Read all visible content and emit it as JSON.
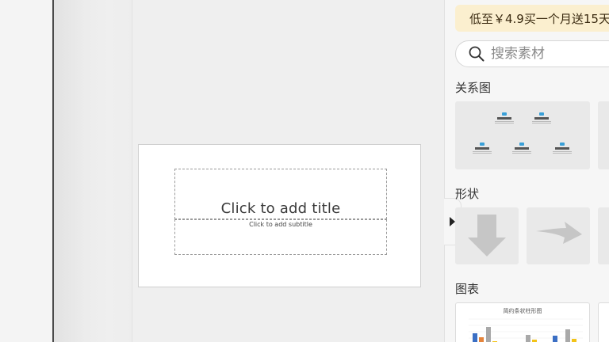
{
  "slide": {
    "title_placeholder": "Click to add title",
    "subtitle_placeholder": "Click to add subtitle"
  },
  "panel": {
    "promo_text": "低至￥4.9买一个月送15天",
    "search_placeholder": "搜索素材",
    "sections": {
      "relation": "关系图",
      "shapes": "形状",
      "charts": "图表"
    },
    "chart_card_title": "简约条状柱形图"
  },
  "colors": {
    "promo_bg": "#fbefcf",
    "accent_blue": "#3aa0d8",
    "bar_blue": "#3b6fc4",
    "bar_orange": "#e5843b",
    "bar_gray": "#a9a9a9",
    "bar_yellow": "#f2c318"
  }
}
